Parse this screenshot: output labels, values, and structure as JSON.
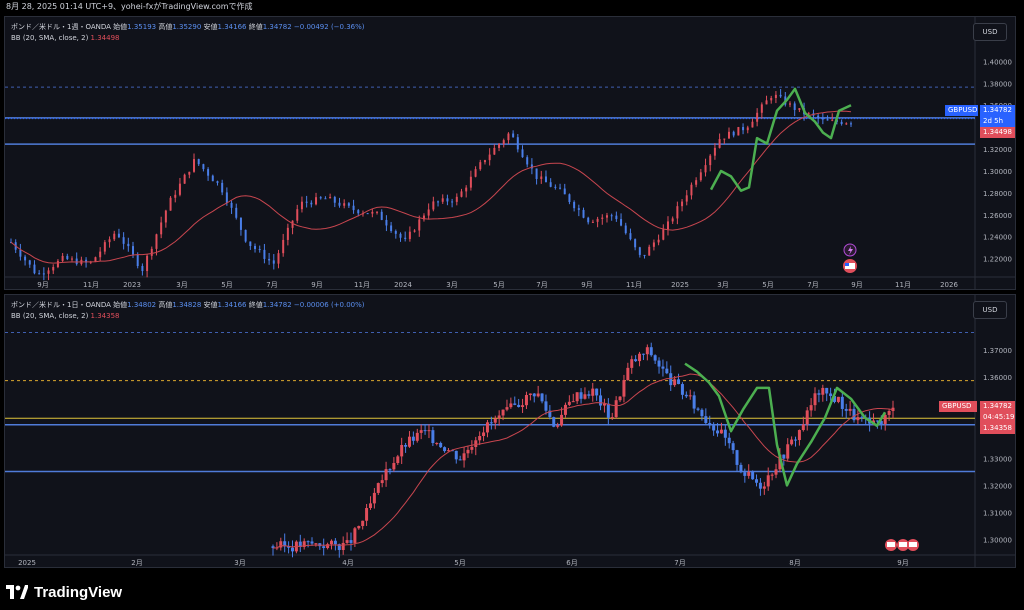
{
  "header": {
    "timestamp": "8月 28, 2025 01:14 UTC+9、yohei-fxがTradingView.comで作成"
  },
  "panel1": {
    "legend_prefix": "ポンド／米ドル・1週・OANDA",
    "open_label": "始値",
    "open": "1.35193",
    "high_label": "高値",
    "high": "1.35290",
    "low_label": "安値",
    "low": "1.34166",
    "close_label": "終値",
    "close": "1.34782",
    "change": "−0.00492 (−0.36%)",
    "bb_label": "BB (20, SMA, close, 2)",
    "bb_value": "1.34498",
    "currency": "USD",
    "price_ticks": [
      "1.40000",
      "1.38000",
      "1.36000",
      "1.34000",
      "1.32000",
      "1.30000",
      "1.28000",
      "1.26000",
      "1.24000",
      "1.22000"
    ],
    "time_ticks": [
      "9月",
      "11月",
      "2023",
      "3月",
      "5月",
      "7月",
      "9月",
      "11月",
      "2024",
      "3月",
      "5月",
      "7月",
      "9月",
      "11月",
      "2025",
      "3月",
      "5月",
      "7月",
      "9月",
      "11月",
      "2026"
    ],
    "symbol_tag": "GBPUSD",
    "price_tag": "1.34782",
    "countdown": "2d 5h",
    "bb_tag": "1.34498"
  },
  "panel2": {
    "legend_prefix": "ポンド／米ドル・1日・OANDA",
    "open_label": "始値",
    "open": "1.34802",
    "high_label": "高値",
    "high": "1.34828",
    "low_label": "安値",
    "low": "1.34166",
    "close_label": "終値",
    "close": "1.34782",
    "change": "−0.00006 (+0.00%)",
    "bb_label": "BB (20, SMA, close, 2)",
    "bb_value": "1.34358",
    "currency": "USD",
    "price_ticks": [
      "1.37000",
      "1.36000",
      "1.35000",
      "1.34000",
      "1.33000",
      "1.32000",
      "1.31000",
      "1.30000"
    ],
    "time_ticks": [
      "2025",
      "2月",
      "3月",
      "4月",
      "5月",
      "6月",
      "7月",
      "8月",
      "9月"
    ],
    "symbol_tag": "GBPUSD",
    "price_tag": "1.34782",
    "countdown": "04:45:19",
    "bb_tag": "1.34358"
  },
  "brand": {
    "name": "TradingView"
  },
  "colors": {
    "up": "#e04e5b",
    "down": "#4a7ee8",
    "bb": "#e04e5b",
    "highlight": "#4caf50",
    "bg": "#10121a"
  }
}
